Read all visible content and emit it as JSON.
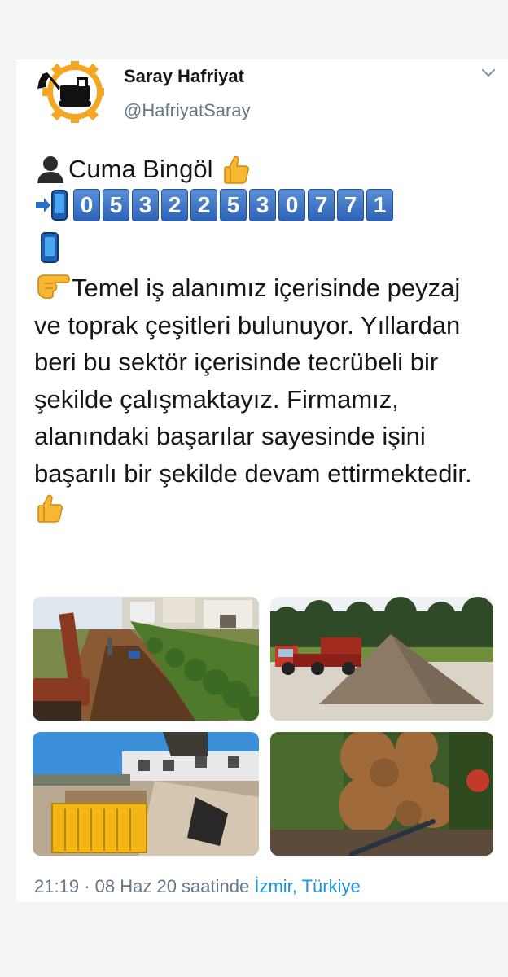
{
  "tweet": {
    "author_name": "Saray Hafriyat",
    "author_handle": "@HafriyatSaray",
    "contact_name": "Cuma Bingöl",
    "phone_digits": [
      "0",
      "5",
      "3",
      "2",
      "2",
      "5",
      "3",
      "0",
      "7",
      "7",
      "1"
    ],
    "paragraph": "Temel iş alanımız içerisinde peyzaj ve toprak çeşitleri bulunuyor. Yıllardan beri bu sektör içerisinde tecrübeli bir şekilde çalışmaktayız. Firmamız, alanındaki başarılar sayesinde işini başarılı bir şekilde devam ettirmektedir.",
    "time": "21:19",
    "separator": "·",
    "date_text": "08 Haz 20 saatinde",
    "location": "İzmir, Türkiye"
  },
  "icons": {
    "person": "bust-silhouette-icon",
    "thumbs": "thumbs-up-icon",
    "arrow_phone": "arrow-to-phone-icon",
    "phone": "mobile-phone-icon",
    "pointing": "pointing-hand-icon",
    "chevron": "chevron-down-icon"
  },
  "colors": {
    "handle": "#657786",
    "link": "#1b95e0",
    "digit_bg": "#2d63b8",
    "logo_ring": "#f5a623"
  }
}
